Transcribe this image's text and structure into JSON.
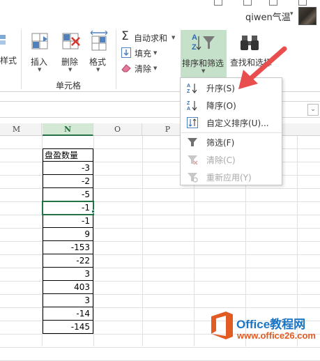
{
  "window": {
    "user_name": "qiwen气温"
  },
  "ribbon": {
    "style_partial": "样式",
    "insert": "插入",
    "delete": "删除",
    "format": "格式",
    "cells_group": "单元格",
    "autosum": "自动求和",
    "fill": "填充",
    "clear": "清除",
    "sort_filter": "排序和筛选",
    "find_select": "查找和选择"
  },
  "sheet": {
    "columns": [
      "M",
      "N",
      "O",
      "P"
    ],
    "header_cell": "盘盈数量",
    "values": [
      "-3",
      "-2",
      "-5",
      "-1",
      "-1",
      "9",
      "-153",
      "-22",
      "3",
      "403",
      "3",
      "-14",
      "-145"
    ],
    "active_value": "-1"
  },
  "menu": {
    "items": [
      {
        "label": "升序(S)",
        "icon": "sort-ascending-icon",
        "enabled": true
      },
      {
        "label": "降序(O)",
        "icon": "sort-descending-icon",
        "enabled": true
      },
      {
        "label": "自定义排序(U)...",
        "icon": "custom-sort-icon",
        "enabled": true
      },
      {
        "label": "筛选(F)",
        "icon": "filter-icon",
        "enabled": true
      },
      {
        "label": "清除(C)",
        "icon": "clear-filter-icon",
        "enabled": false
      },
      {
        "label": "重新应用(Y)",
        "icon": "reapply-filter-icon",
        "enabled": false
      }
    ]
  },
  "watermark": {
    "brand": "Office教程网",
    "url": "www.office26.com"
  },
  "colors": {
    "accent_green": "#217346",
    "highlight_green": "#c5e1c9",
    "arrow_red": "#e94e4e",
    "brand_blue": "#1a75c4",
    "brand_orange": "#e15b23"
  }
}
